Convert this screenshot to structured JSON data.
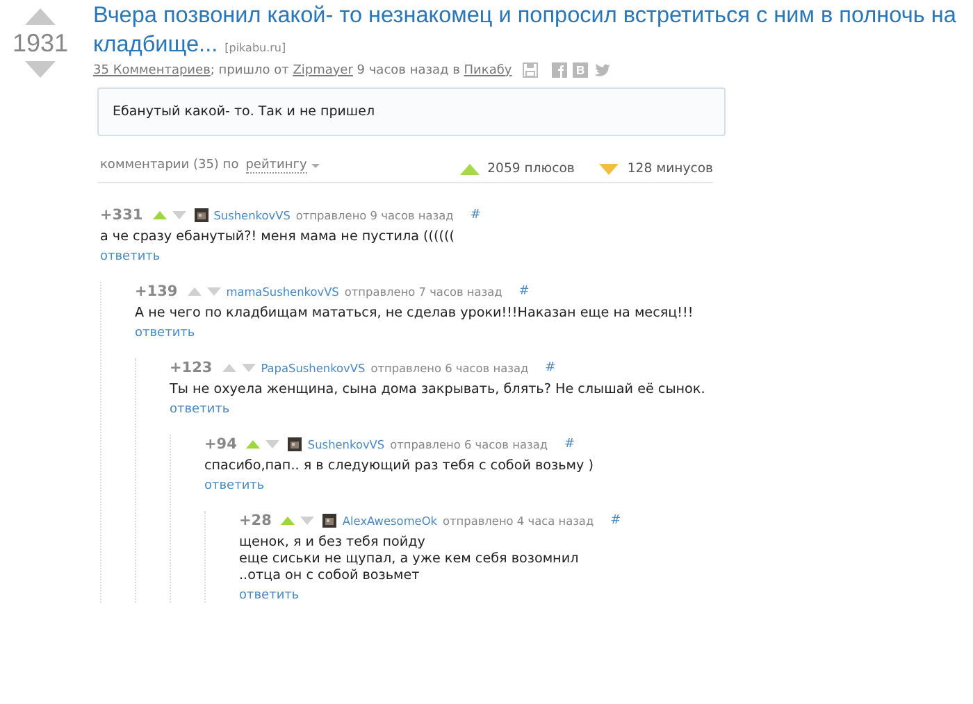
{
  "story": {
    "rating": "1931",
    "title_lines": [
      "Вчера позвонил какой- то незнакомец и попросил встретиться с ним в полночь на",
      "кладбище..."
    ],
    "source": "[pikabu.ru]",
    "meta": [
      {
        "kind": "link",
        "text": "35 Комментариев"
      },
      {
        "kind": "text",
        "text": "; пришло от "
      },
      {
        "kind": "link",
        "text": "Zipmayer"
      },
      {
        "kind": "text",
        "text": " 9 часов назад в "
      },
      {
        "kind": "link",
        "text": "Пикабу"
      }
    ],
    "body": "Ебанутый какой- то. Так и не пришел"
  },
  "comments_header": {
    "label": "комментарии (35) по",
    "sort": "рейтингу",
    "pluses": "2059 плюсов",
    "minuses": "128 минусов"
  },
  "comments": [
    {
      "score": "+331",
      "voted_up": true,
      "avatar": true,
      "author": "SushenkovVS",
      "time": "отправлено 9 часов назад",
      "anchor": "#",
      "text": "а че сразу ебанутый?! меня мама не пустила ((((((",
      "reply": "ответить",
      "children": [
        {
          "score": "+139",
          "voted_up": false,
          "avatar": false,
          "author": "mamaSushenkovVS",
          "time": "отправлено 7 часов назад",
          "anchor": "#",
          "text": "А не чего по кладбищам мататься, не сделав уроки!!!Наказан еще на месяц!!!",
          "reply": "ответить",
          "children": [
            {
              "score": "+123",
              "voted_up": false,
              "avatar": false,
              "author": "PapaSushenkovVS",
              "time": "отправлено 6 часов назад",
              "anchor": "#",
              "text": "Ты не охуела женщина, сына дома закрывать, блять? Не слышай её сынок.",
              "reply": "ответить",
              "children": [
                {
                  "score": "+94",
                  "voted_up": true,
                  "avatar": true,
                  "author": "SushenkovVS",
                  "time": "отправлено 6 часов назад",
                  "anchor": "#",
                  "text": "спасибо,пап.. я в следующий раз тебя с собой возьму )",
                  "reply": "ответить",
                  "children": [
                    {
                      "score": "+28",
                      "voted_up": true,
                      "avatar": true,
                      "author": "AlexAwesomeOk",
                      "time": "отправлено 4 часа назад",
                      "anchor": "#",
                      "text": "щенок, я и без тебя пойду\nеще сиськи не щупал, а уже кем себя возомнил\n..отца он с собой возьмет",
                      "reply": "ответить"
                    }
                  ]
                }
              ]
            }
          ]
        }
      ]
    }
  ]
}
